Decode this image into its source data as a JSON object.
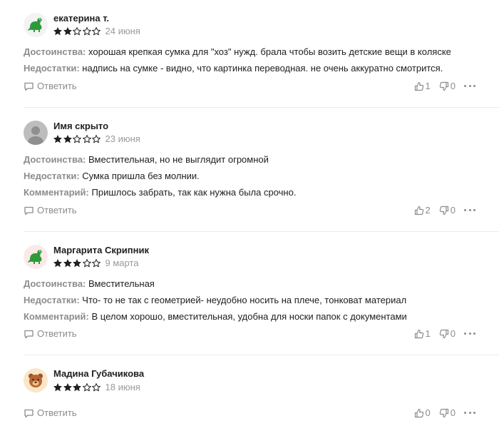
{
  "labels": {
    "pros": "Достоинства:",
    "cons": "Недостатки:",
    "comment": "Комментарий:",
    "reply": "Ответить"
  },
  "reviews": [
    {
      "author": "екатерина т.",
      "avatar_icon": "dinosaur-icon",
      "rating": 2,
      "max_rating": 5,
      "date": "24 июня",
      "pros": "хорошая крепкая сумка для \"хоз\" нужд. брала чтобы возить детские вещи в коляске",
      "cons": "надпись на сумке - видно, что картинка переводная. не очень аккуратно смотрится.",
      "likes": "1",
      "dislikes": "0"
    },
    {
      "author": "Имя скрыто",
      "avatar_icon": "anonymous-user-icon",
      "rating": 2,
      "max_rating": 5,
      "date": "23 июня",
      "pros": "Вместительная, но не выглядит огромной",
      "cons": "Сумка пришла без молнии.",
      "comment": "Пришлось забрать, так как нужна была срочно.",
      "likes": "2",
      "dislikes": "0"
    },
    {
      "author": "Маргарита Скрипник",
      "avatar_icon": "dinosaur-icon",
      "rating": 3,
      "max_rating": 5,
      "date": "9 марта",
      "pros": "Вместительная",
      "cons": "Что- то не так с геометрией- неудобно носить на плече, тонковат материал",
      "comment": "В целом хорошо, вместительная, удобна для носки папок с документами",
      "likes": "1",
      "dislikes": "0"
    },
    {
      "author": "Мадина Губачикова",
      "avatar_icon": "bear-icon",
      "rating": 3,
      "max_rating": 5,
      "date": "18 июня",
      "likes": "0",
      "dislikes": "0"
    }
  ],
  "colors": {
    "star_filled": "#21201f",
    "star_empty": "#21201f",
    "muted_text": "#8c8c8c",
    "date_text": "#999999",
    "separator": "#ececec"
  }
}
